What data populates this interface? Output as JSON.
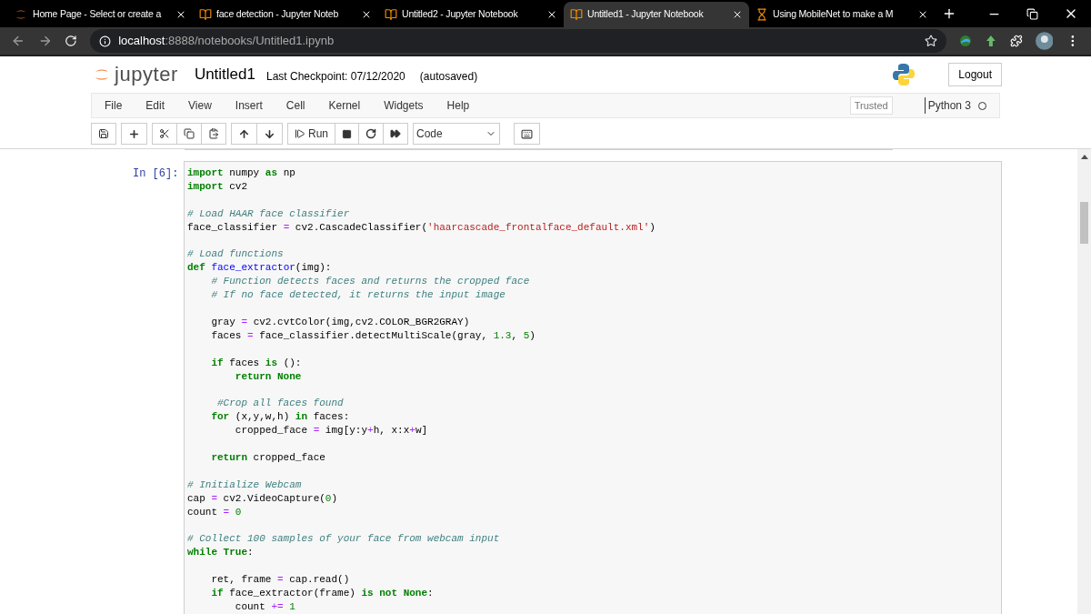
{
  "browser": {
    "tabs": [
      {
        "title": "Home Page - Select or create a",
        "kind": "home",
        "selected": false
      },
      {
        "title": "face detection - Jupyter Noteb",
        "kind": "notebook",
        "selected": false
      },
      {
        "title": "Untitled2 - Jupyter Notebook",
        "kind": "notebook",
        "selected": false
      },
      {
        "title": "Untitled1 - Jupyter Notebook",
        "kind": "notebook",
        "selected": true
      },
      {
        "title": "Using MobileNet to make a M",
        "kind": "loading",
        "selected": false
      }
    ],
    "url_host": "localhost",
    "url_path": ":8888/notebooks/Untitled1.ipynb"
  },
  "header": {
    "logo": "jupyter",
    "notebook_name": "Untitled1",
    "checkpoint": "Last Checkpoint: 07/12/2020",
    "autosave": "(autosaved)",
    "logout": "Logout"
  },
  "menu": [
    "File",
    "Edit",
    "View",
    "Insert",
    "Cell",
    "Kernel",
    "Widgets",
    "Help"
  ],
  "trusted": "Trusted",
  "kernel": {
    "name": "Python 3",
    "busy": false
  },
  "toolbar": {
    "run": "Run",
    "cell_type": "Code"
  },
  "cell": {
    "prompt": "In [6]:",
    "lines": [
      {
        "kind": "code",
        "tokens": [
          {
            "kind": "kw",
            "text": "import"
          },
          {
            "kind": "pl",
            "text": " numpy "
          },
          {
            "kind": "kw",
            "text": "as"
          },
          {
            "kind": "pl",
            "text": " np"
          }
        ]
      },
      {
        "kind": "code",
        "tokens": [
          {
            "kind": "kw",
            "text": "import"
          },
          {
            "kind": "pl",
            "text": " cv2"
          }
        ]
      },
      {
        "kind": "blank"
      },
      {
        "kind": "code",
        "tokens": [
          {
            "kind": "cm",
            "text": "# Load HAAR face classifier"
          }
        ]
      },
      {
        "kind": "code",
        "tokens": [
          {
            "kind": "pl",
            "text": "face_classifier "
          },
          {
            "kind": "op",
            "text": "="
          },
          {
            "kind": "pl",
            "text": " cv2.CascadeClassifier("
          },
          {
            "kind": "str",
            "text": "'haarcascade_frontalface_default.xml'"
          },
          {
            "kind": "pl",
            "text": ")"
          }
        ]
      },
      {
        "kind": "blank"
      },
      {
        "kind": "code",
        "tokens": [
          {
            "kind": "cm",
            "text": "# Load functions"
          }
        ]
      },
      {
        "kind": "code",
        "tokens": [
          {
            "kind": "kw",
            "text": "def"
          },
          {
            "kind": "fn",
            "text": " face_extractor"
          },
          {
            "kind": "pl",
            "text": "(img):"
          }
        ]
      },
      {
        "kind": "code",
        "tokens": [
          {
            "kind": "cm",
            "text": "    # Function detects faces and returns the cropped face"
          }
        ]
      },
      {
        "kind": "code",
        "tokens": [
          {
            "kind": "cm",
            "text": "    # If no face detected, it returns the input image"
          }
        ]
      },
      {
        "kind": "blank"
      },
      {
        "kind": "code",
        "tokens": [
          {
            "kind": "pl",
            "text": "    gray "
          },
          {
            "kind": "op",
            "text": "="
          },
          {
            "kind": "pl",
            "text": " cv2.cvtColor(img,cv2.COLOR_BGR2GRAY)"
          }
        ]
      },
      {
        "kind": "code",
        "tokens": [
          {
            "kind": "pl",
            "text": "    faces "
          },
          {
            "kind": "op",
            "text": "="
          },
          {
            "kind": "pl",
            "text": " face_classifier.detectMultiScale(gray, "
          },
          {
            "kind": "num",
            "text": "1.3"
          },
          {
            "kind": "pl",
            "text": ", "
          },
          {
            "kind": "num",
            "text": "5"
          },
          {
            "kind": "pl",
            "text": ")"
          }
        ]
      },
      {
        "kind": "blank"
      },
      {
        "kind": "code",
        "tokens": [
          {
            "kind": "kw",
            "text": "    if"
          },
          {
            "kind": "pl",
            "text": " faces "
          },
          {
            "kind": "kw",
            "text": "is"
          },
          {
            "kind": "pl",
            "text": " ():"
          }
        ]
      },
      {
        "kind": "code",
        "tokens": [
          {
            "kind": "kw",
            "text": "        return None"
          }
        ]
      },
      {
        "kind": "blank"
      },
      {
        "kind": "code",
        "tokens": [
          {
            "kind": "cm",
            "text": "     #Crop all faces found"
          }
        ]
      },
      {
        "kind": "code",
        "tokens": [
          {
            "kind": "kw",
            "text": "    for"
          },
          {
            "kind": "pl",
            "text": " (x,y,w,h) "
          },
          {
            "kind": "kw",
            "text": "in"
          },
          {
            "kind": "pl",
            "text": " faces:"
          }
        ]
      },
      {
        "kind": "code",
        "tokens": [
          {
            "kind": "pl",
            "text": "        cropped_face "
          },
          {
            "kind": "op",
            "text": "="
          },
          {
            "kind": "pl",
            "text": " img[y:y"
          },
          {
            "kind": "op",
            "text": "+"
          },
          {
            "kind": "pl",
            "text": "h, x:x"
          },
          {
            "kind": "op",
            "text": "+"
          },
          {
            "kind": "pl",
            "text": "w]"
          }
        ]
      },
      {
        "kind": "blank"
      },
      {
        "kind": "code",
        "tokens": [
          {
            "kind": "kw",
            "text": "    return"
          },
          {
            "kind": "pl",
            "text": " cropped_face"
          }
        ]
      },
      {
        "kind": "blank"
      },
      {
        "kind": "code",
        "tokens": [
          {
            "kind": "cm",
            "text": "# Initialize Webcam"
          }
        ]
      },
      {
        "kind": "code",
        "tokens": [
          {
            "kind": "pl",
            "text": "cap "
          },
          {
            "kind": "op",
            "text": "="
          },
          {
            "kind": "pl",
            "text": " cv2.VideoCapture("
          },
          {
            "kind": "num",
            "text": "0"
          },
          {
            "kind": "pl",
            "text": ")"
          }
        ]
      },
      {
        "kind": "code",
        "tokens": [
          {
            "kind": "pl",
            "text": "count "
          },
          {
            "kind": "op",
            "text": "="
          },
          {
            "kind": "num",
            "text": " 0"
          }
        ]
      },
      {
        "kind": "blank"
      },
      {
        "kind": "code",
        "tokens": [
          {
            "kind": "cm",
            "text": "# Collect 100 samples of your face from webcam input"
          }
        ]
      },
      {
        "kind": "code",
        "tokens": [
          {
            "kind": "kw",
            "text": "while True"
          },
          {
            "kind": "pl",
            "text": ":"
          }
        ]
      },
      {
        "kind": "blank"
      },
      {
        "kind": "code",
        "tokens": [
          {
            "kind": "pl",
            "text": "    ret, frame "
          },
          {
            "kind": "op",
            "text": "="
          },
          {
            "kind": "pl",
            "text": " cap.read()"
          }
        ]
      },
      {
        "kind": "code",
        "tokens": [
          {
            "kind": "kw",
            "text": "    if"
          },
          {
            "kind": "pl",
            "text": " face_extractor(frame) "
          },
          {
            "kind": "kw",
            "text": "is not None"
          },
          {
            "kind": "pl",
            "text": ":"
          }
        ]
      },
      {
        "kind": "code",
        "tokens": [
          {
            "kind": "pl",
            "text": "        count "
          },
          {
            "kind": "op",
            "text": "+="
          },
          {
            "kind": "num",
            "text": " 1"
          }
        ]
      }
    ]
  }
}
